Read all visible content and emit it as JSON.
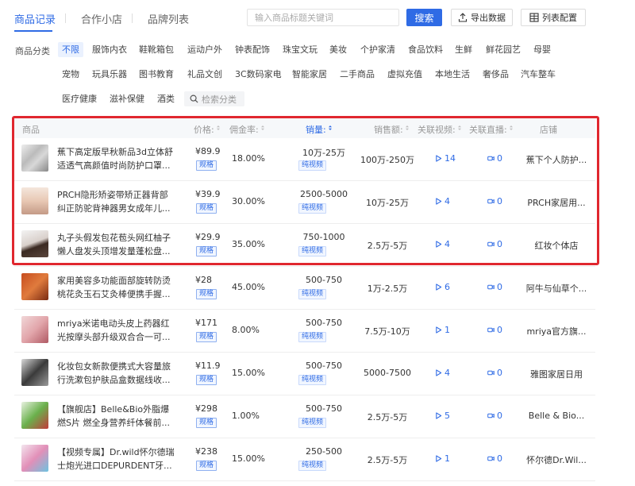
{
  "tabs": [
    {
      "label": "商品记录",
      "active": true
    },
    {
      "label": "合作小店",
      "active": false
    },
    {
      "label": "品牌列表",
      "active": false
    }
  ],
  "search": {
    "placeholder": "输入商品标题关键词",
    "button_label": "搜索"
  },
  "toolbar": {
    "export_label": "导出数据",
    "config_label": "列表配置"
  },
  "category": {
    "label": "商品分类",
    "rows": [
      [
        "不限",
        "服饰内衣",
        "鞋靴箱包",
        "运动户外",
        "钟表配饰",
        "珠宝文玩",
        "美妆",
        "个护家清",
        "食品饮料",
        "生鲜",
        "鲜花园艺",
        "母婴"
      ],
      [
        "宠物",
        "玩具乐器",
        "图书教育",
        "礼品文创",
        "3C数码家电",
        "智能家居",
        "二手商品",
        "虚拟充值",
        "本地生活",
        "奢侈品",
        "汽车整车"
      ],
      [
        "医疗健康",
        "滋补保健",
        "酒类"
      ]
    ],
    "selected": "不限",
    "search_placeholder": "检索分类"
  },
  "table": {
    "headers": {
      "product": "商品",
      "price": "价格:",
      "commission": "佣金率:",
      "sales": "销量:",
      "amount": "销售额:",
      "videos": "关联视频:",
      "live": "关联直播:",
      "shop": "店铺"
    },
    "spec_label": "规格",
    "rows": [
      {
        "title1": "蕉下高定版早秋新品3d立体舒",
        "title2": "适透气高颜值时尚防护口罩...",
        "price": "¥89.9",
        "commission": "18.00%",
        "sales": "10万-25万",
        "sales_tag": "纯视频",
        "amount": "100万-250万",
        "videos": "14",
        "live": "0",
        "shop": "蕉下个人防护..."
      },
      {
        "title1": "PRCH隐形矫姿带矫正器背部",
        "title2": "纠正防驼背神器男女成年儿...",
        "price": "¥39.9",
        "commission": "30.00%",
        "sales": "2500-5000",
        "sales_tag": "纯视频",
        "amount": "10万-25万",
        "videos": "4",
        "live": "0",
        "shop": "PRCH家居用..."
      },
      {
        "title1": "丸子头假发包花苞头网红柚子",
        "title2": "懒人盘发头顶增发量蓬松盘...",
        "price": "¥29.9",
        "commission": "35.00%",
        "sales": "750-1000",
        "sales_tag": "纯视频",
        "amount": "2.5万-5万",
        "videos": "4",
        "live": "0",
        "shop": "红妆个体店"
      },
      {
        "title1": "家用美容多功能面部旋转防烫",
        "title2": "桃花灸玉石艾灸棒便携手握...",
        "price": "¥28",
        "commission": "45.00%",
        "sales": "500-750",
        "sales_tag": "纯视频",
        "amount": "1万-2.5万",
        "videos": "6",
        "live": "0",
        "shop": "阿牛与仙草个..."
      },
      {
        "title1": "mriya米诺电动头皮上药器红",
        "title2": "光按摩头部升级双合合一可...",
        "price": "¥171",
        "commission": "8.00%",
        "sales": "500-750",
        "sales_tag": "纯视频",
        "amount": "7.5万-10万",
        "videos": "1",
        "live": "0",
        "shop": "mriya官方旗..."
      },
      {
        "title1": "化妆包女新款便携式大容量旅",
        "title2": "行洗漱包护肤品盒数据线收...",
        "price": "¥11.9",
        "commission": "15.00%",
        "sales": "500-750",
        "sales_tag": "纯视频",
        "amount": "5000-7500",
        "videos": "4",
        "live": "0",
        "shop": "雅图家居日用"
      },
      {
        "title1": "【旗舰店】Belle&Bio外脂爆",
        "title2": "燃S片 燃全身营养纤体餐前...",
        "price": "¥298",
        "commission": "1.00%",
        "sales": "500-750",
        "sales_tag": "纯视频",
        "amount": "2.5万-5万",
        "videos": "5",
        "live": "0",
        "shop": "Belle & Bio..."
      },
      {
        "title1": "【视频专属】Dr.wild怀尔德瑞",
        "title2": "士炮光进口DEPURDENT牙...",
        "price": "¥238",
        "commission": "15.00%",
        "sales": "250-500",
        "sales_tag": "纯视频",
        "amount": "2.5万-5万",
        "videos": "1",
        "live": "0",
        "shop": "怀尔德Dr.Wil..."
      }
    ]
  },
  "colors": {
    "accent": "#2f6be5",
    "highlight": "#e0272f"
  }
}
